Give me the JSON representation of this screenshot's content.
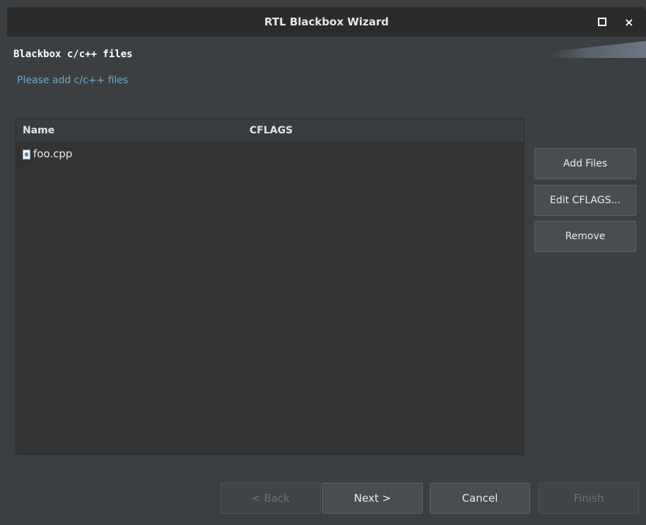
{
  "window": {
    "title": "RTL Blackbox Wizard",
    "maximize_icon": "maximize-icon",
    "close_icon": "close-icon",
    "close_glyph": "×"
  },
  "header": {
    "title": "Blackbox c/c++ files",
    "description": "Please add c/c++ files"
  },
  "table": {
    "columns": [
      "Name",
      "CFLAGS"
    ],
    "rows": [
      {
        "name": "foo.cpp",
        "cflags": "",
        "icon": "c-source-file-icon"
      }
    ]
  },
  "side_buttons": {
    "add": "Add Files",
    "edit": "Edit CFLAGS...",
    "remove": "Remove"
  },
  "nav_buttons": {
    "back": "< Back",
    "next": "Next >",
    "cancel": "Cancel",
    "finish": "Finish"
  },
  "colors": {
    "background": "#3c3f41",
    "title_bar": "#2b2b2b",
    "table_bg": "#313335",
    "description_text": "#6fa8c6"
  }
}
